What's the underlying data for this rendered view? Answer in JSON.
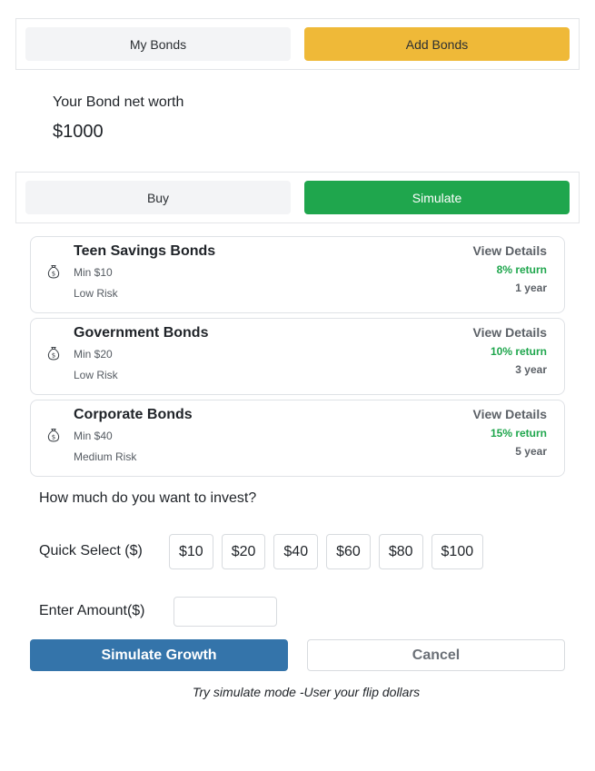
{
  "top_tabs": {
    "my_bonds": "My Bonds",
    "add_bonds": "Add Bonds"
  },
  "networth": {
    "label": "Your Bond net worth",
    "value": "$1000"
  },
  "mode_tabs": {
    "buy": "Buy",
    "simulate": "Simulate"
  },
  "bonds": [
    {
      "name": "Teen Savings Bonds",
      "min": "Min $10",
      "risk": "Low Risk",
      "view": "View Details",
      "return": "8% return",
      "term": "1 year",
      "icon": "money-bag-icon"
    },
    {
      "name": "Government Bonds",
      "min": "Min $20",
      "risk": "Low Risk",
      "view": "View Details",
      "return": "10% return",
      "term": "3 year",
      "icon": "money-bag-icon"
    },
    {
      "name": "Corporate Bonds",
      "min": "Min $40",
      "risk": "Medium Risk",
      "view": "View Details",
      "return": "15% return",
      "term": "5 year",
      "icon": "money-bag-icon"
    }
  ],
  "invest": {
    "question": "How much do you want to invest?",
    "quick_label": "Quick Select ($)",
    "quick_options": [
      "$10",
      "$20",
      "$40",
      "$60",
      "$80",
      "$100"
    ],
    "amount_label": "Enter Amount($)",
    "amount_value": "",
    "amount_placeholder": ""
  },
  "actions": {
    "simulate": "Simulate Growth",
    "cancel": "Cancel"
  },
  "hint": "Try simulate mode -User your flip dollars",
  "colors": {
    "add_active": "#efb938",
    "simulate_active": "#1fa64d",
    "primary_button": "#3474aa",
    "return_text": "#1fa64d"
  }
}
